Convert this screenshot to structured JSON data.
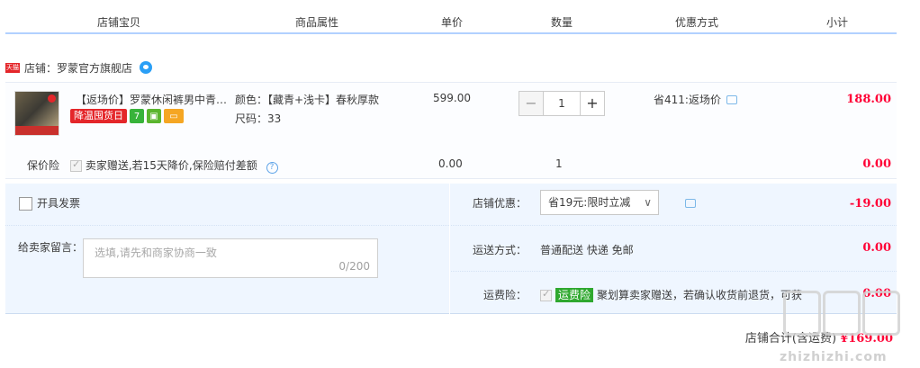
{
  "header": {
    "columns": [
      "店铺宝贝",
      "商品属性",
      "单价",
      "数量",
      "优惠方式",
      "小计"
    ]
  },
  "shop": {
    "badge": "天猫",
    "label": "店铺：罗蒙官方旗舰店"
  },
  "item": {
    "title": "【返场价】罗蒙休闲裤男中青年...",
    "promo_tag": "降温囤货日",
    "tag_seven": "7",
    "color_attr": "颜色：【藏青+浅卡】春秋厚款",
    "size_attr": "尺码：33",
    "unit_price": "599.00",
    "qty_minus": "−",
    "quantity": "1",
    "qty_plus": "+",
    "discount_label": "省411:返场价",
    "subtotal": "188.00"
  },
  "insurance": {
    "label": "保价险",
    "desc": "卖家赠送,若15天降价,保险赔付差额",
    "price": "0.00",
    "quantity": "1",
    "subtotal": "0.00"
  },
  "order": {
    "invoice_label": "开具发票",
    "message_label": "给卖家留言：",
    "message_placeholder": "选填,请先和商家协商一致",
    "message_counter": "0/200",
    "shop_discount_label": "店铺优惠：",
    "shop_discount_value": "省19元:限时立减",
    "shop_discount_amount": "-19.00",
    "shipping_label": "运送方式：",
    "shipping_value": "普通配送 快递 免邮",
    "shipping_amount": "0.00",
    "freight_ins_label": "运费险：",
    "freight_ins_tag": "运费险",
    "freight_ins_desc": "聚划算卖家赠送，若确认收货前退货，可获",
    "freight_ins_amount": "0.00"
  },
  "total": {
    "label": "店铺合计(含运费)",
    "amount": "¥169.00"
  },
  "watermark": {
    "text": "zhizhizhi.com"
  },
  "colors": {
    "accent_red": "#ff0036",
    "panel_blue": "#eff6ff",
    "header_border": "#b2d1ff",
    "tmall_red": "#e4262a"
  }
}
